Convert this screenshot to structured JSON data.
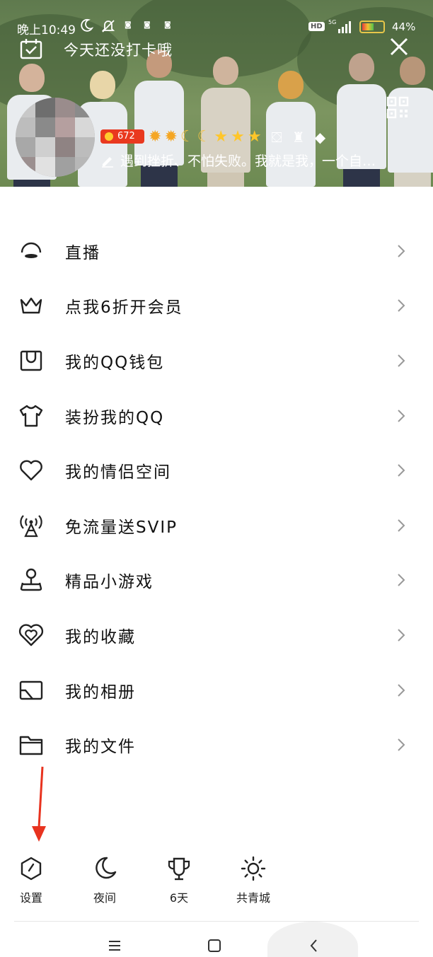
{
  "status_bar": {
    "time": "晚上10:49",
    "badges": [
      "HD",
      "5G"
    ],
    "battery": "44%",
    "icons": [
      "moon-icon",
      "mute-icon",
      "signal-icon",
      "battery-icon"
    ]
  },
  "header": {
    "checkin_text": "今天还没打卡哦",
    "level_value": "672",
    "signature": "遇到挫折、不怕失败。我就是我，一个自…",
    "icons": [
      "calendar-check-icon",
      "close-icon",
      "qr-code-icon",
      "pen-icon"
    ]
  },
  "menu": {
    "items": [
      {
        "label": "直播",
        "icon": "live-icon"
      },
      {
        "label": "点我6折开会员",
        "icon": "crown-icon"
      },
      {
        "label": "我的QQ钱包",
        "icon": "wallet-icon"
      },
      {
        "label": "装扮我的QQ",
        "icon": "tshirt-icon"
      },
      {
        "label": "我的情侣空间",
        "icon": "heart-icon"
      },
      {
        "label": "免流量送SVIP",
        "icon": "antenna-icon"
      },
      {
        "label": "精品小游戏",
        "icon": "game-icon"
      },
      {
        "label": "我的收藏",
        "icon": "favorite-icon"
      },
      {
        "label": "我的相册",
        "icon": "album-icon"
      },
      {
        "label": "我的文件",
        "icon": "folder-icon"
      }
    ]
  },
  "toolbar": {
    "items": [
      {
        "label": "设置",
        "icon": "settings-icon"
      },
      {
        "label": "夜间",
        "icon": "night-mode-icon"
      },
      {
        "label": "6天",
        "icon": "trophy-icon"
      },
      {
        "label": "共青城",
        "icon": "weather-sun-icon"
      }
    ]
  },
  "colors": {
    "level_badge": "#e9391f",
    "annotation_arrow": "#e8331f",
    "text_primary": "#111111"
  }
}
